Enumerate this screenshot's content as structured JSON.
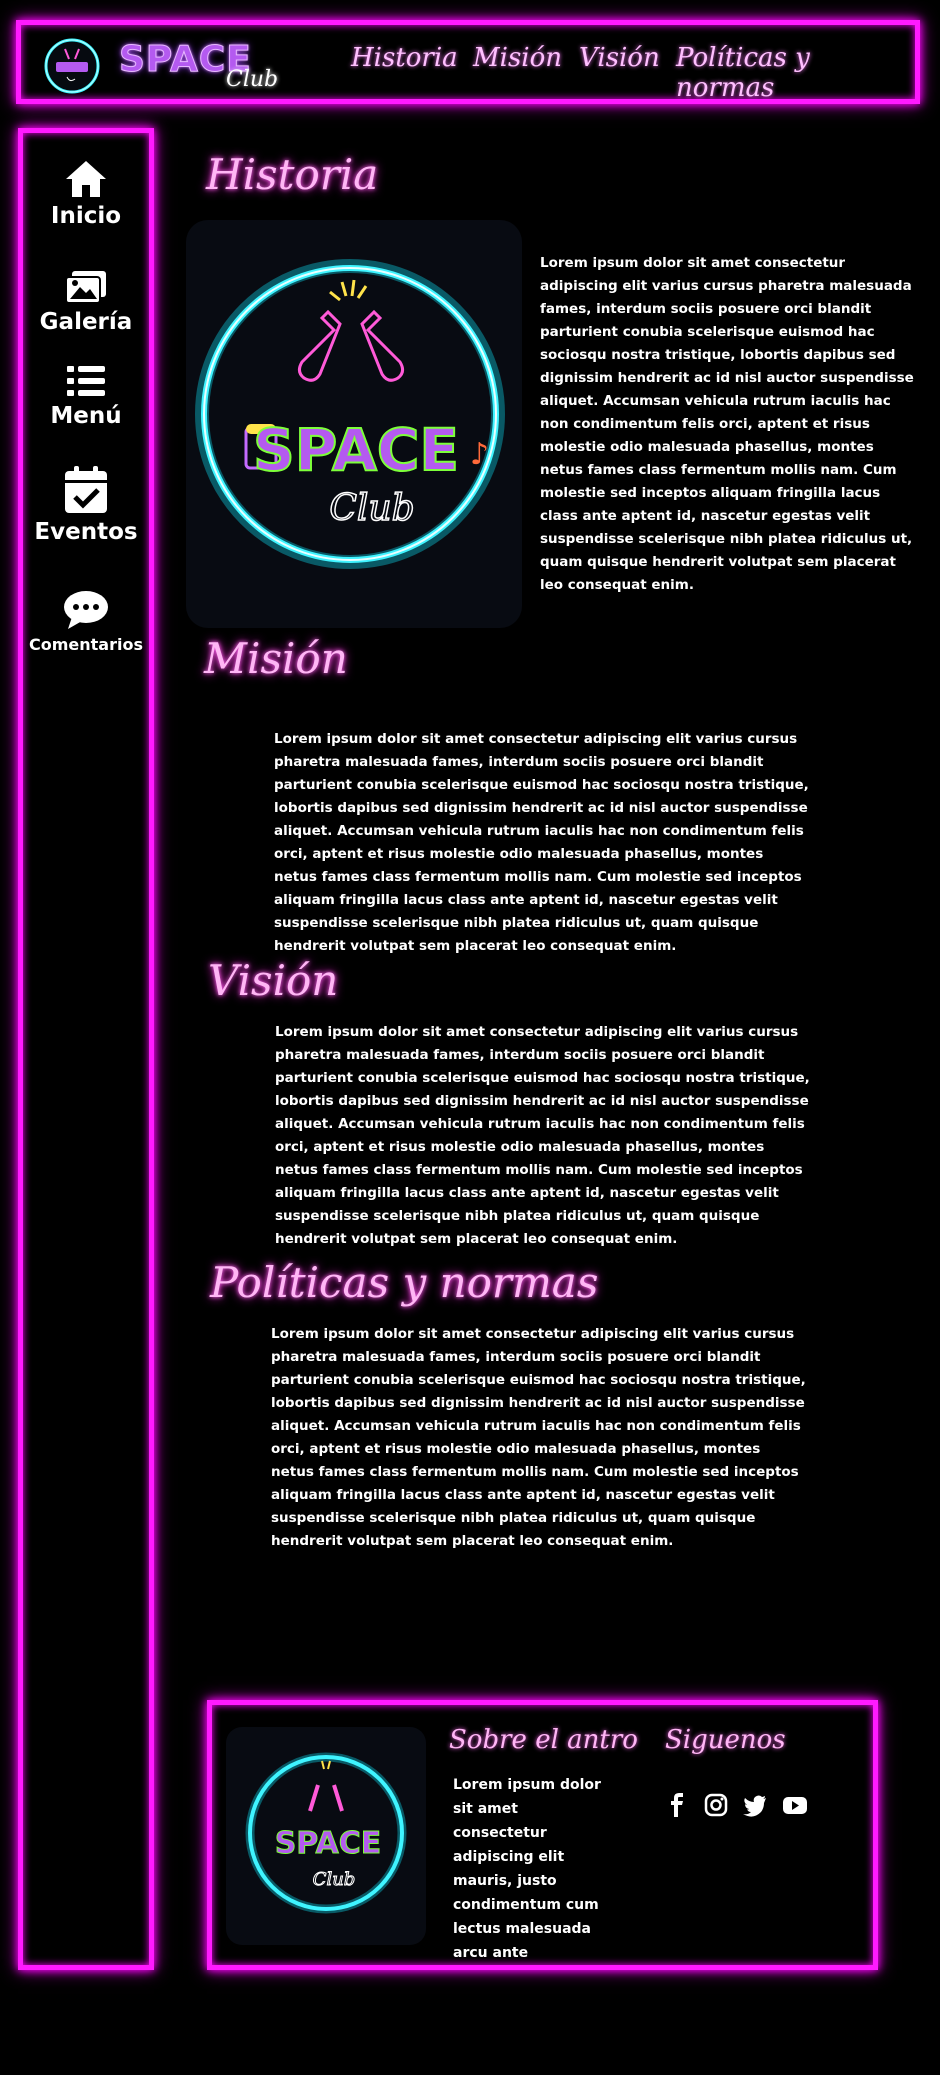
{
  "brand": {
    "word": "SPACE",
    "script": "Club"
  },
  "nav": [
    "Historia",
    "Misión",
    "Visión",
    "Políticas y normas"
  ],
  "sidebar": [
    {
      "label": "Inicio",
      "icon": "home-icon"
    },
    {
      "label": "Galería",
      "icon": "images-icon"
    },
    {
      "label": "Menú",
      "icon": "list-icon"
    },
    {
      "label": "Eventos",
      "icon": "calendar-check-icon"
    },
    {
      "label": "Comentarios",
      "icon": "comments-icon"
    }
  ],
  "sections": {
    "historia": {
      "title": "Historia",
      "text": "Lorem ipsum dolor sit amet consectetur adipiscing elit varius cursus pharetra malesuada fames, interdum sociis posuere orci blandit parturient conubia scelerisque euismod hac sociosqu nostra tristique, lobortis dapibus sed dignissim hendrerit ac id nisl auctor suspendisse aliquet. Accumsan vehicula rutrum iaculis hac non condimentum felis orci, aptent et risus molestie odio malesuada phasellus, montes netus fames class fermentum mollis nam. Cum molestie sed inceptos aliquam fringilla lacus class ante aptent id, nascetur egestas velit suspendisse scelerisque nibh platea ridiculus ut, quam quisque hendrerit volutpat sem placerat leo consequat enim."
    },
    "mision": {
      "title": "Misión",
      "text": "Lorem ipsum dolor sit amet consectetur adipiscing elit varius cursus pharetra malesuada fames, interdum sociis posuere orci blandit parturient conubia scelerisque euismod hac sociosqu nostra tristique, lobortis dapibus sed dignissim hendrerit ac id nisl auctor suspendisse aliquet. Accumsan vehicula rutrum iaculis hac non condimentum felis orci, aptent et risus molestie odio malesuada phasellus, montes netus fames class fermentum mollis nam. Cum molestie sed inceptos aliquam fringilla lacus class ante aptent id, nascetur egestas velit suspendisse scelerisque nibh platea ridiculus ut, quam quisque hendrerit volutpat sem placerat leo consequat enim."
    },
    "vision": {
      "title": "Visión",
      "text": "Lorem ipsum dolor sit amet consectetur adipiscing elit varius cursus pharetra malesuada fames, interdum sociis posuere orci blandit parturient conubia scelerisque euismod hac sociosqu nostra tristique, lobortis dapibus sed dignissim hendrerit ac id nisl auctor suspendisse aliquet. Accumsan vehicula rutrum iaculis hac non condimentum felis orci, aptent et risus molestie odio malesuada phasellus, montes netus fames class fermentum mollis nam. Cum molestie sed inceptos aliquam fringilla lacus class ante aptent id, nascetur egestas velit suspendisse scelerisque nibh platea ridiculus ut, quam quisque hendrerit volutpat sem placerat leo consequat enim."
    },
    "politicas": {
      "title": "Políticas y normas",
      "text": "Lorem ipsum dolor sit amet consectetur adipiscing elit varius cursus pharetra malesuada fames, interdum sociis posuere orci blandit parturient conubia scelerisque euismod hac sociosqu nostra tristique, lobortis dapibus sed dignissim hendrerit ac id nisl auctor suspendisse aliquet. Accumsan vehicula rutrum iaculis hac non condimentum felis orci, aptent et risus molestie odio malesuada phasellus, montes netus fames class fermentum mollis nam. Cum molestie sed inceptos aliquam fringilla lacus class ante aptent id, nascetur egestas velit suspendisse scelerisque nibh platea ridiculus ut, quam quisque hendrerit volutpat sem placerat leo consequat enim."
    }
  },
  "footer": {
    "about_title": "Sobre el antro",
    "about_text": "Lorem ipsum dolor sit amet consectetur adipiscing elit mauris, justo condimentum cum lectus malesuada arcu ante",
    "follow_title": "Siguenos",
    "social": [
      "facebook-icon",
      "instagram-icon",
      "twitter-icon",
      "youtube-icon"
    ]
  },
  "colors": {
    "neon_magenta": "#ff1aff",
    "title_pink": "#ffb6f5",
    "ring_cyan": "#3ff4ff",
    "logo_purple": "#b45af0",
    "logo_green": "#7dff3a"
  }
}
